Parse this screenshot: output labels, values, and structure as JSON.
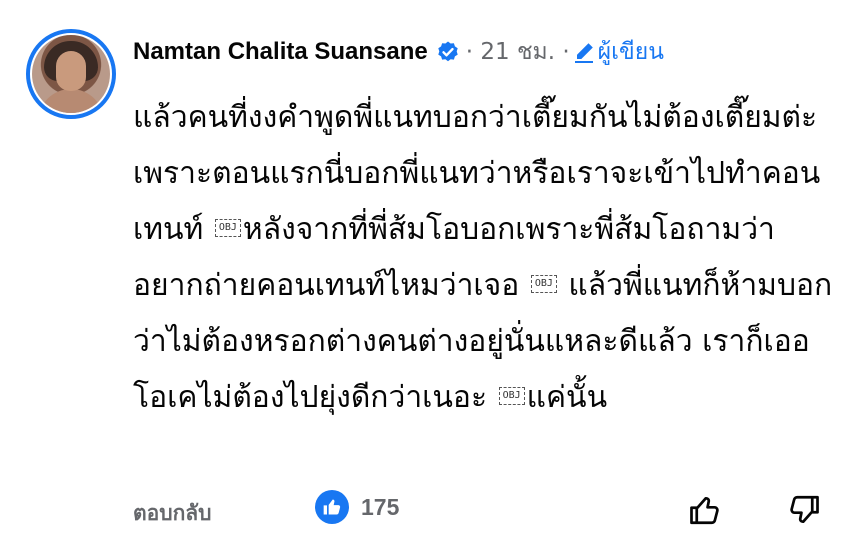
{
  "comment": {
    "author": "Namtan Chalita Suansane",
    "time": "· 21 ชม. ·",
    "author_badge": "ผู้เขียน",
    "text_parts": [
      "แล้วคนที่งงคำพูดพี่แนทบอกว่าเตี๊ยมกันไม่ต้องเตี๊ยมต่ะ เพราะตอนแรกนี่บอกพี่แนทว่าหรือเราจะเข้าไปทำคอนเทนท์ ",
      "หลังจากที่พี่ส้มโอบอกเพราะพี่ส้มโอถามว่าอยากถ่ายคอนเทนท์ไหมว่าเจอ ",
      " แล้วพี่แนทก็ห้ามบอกว่าไม่ต้องหรอกต่างคนต่างอยู่นั่นแหละดีแล้ว เราก็เออโอเคไม่ต้องไปยุ่งดีกว่าเนอะ ",
      "แค่นั้น"
    ],
    "obj_placeholder": "OBJ",
    "reply_label": "ตอบกลับ",
    "like_count": "175"
  },
  "colors": {
    "accent": "#1877f2",
    "meta": "#65676b",
    "text": "#050505"
  },
  "icons": [
    "verified-badge-icon",
    "pencil-icon",
    "like-reaction-icon",
    "thumbs-up-icon",
    "thumbs-down-icon"
  ]
}
